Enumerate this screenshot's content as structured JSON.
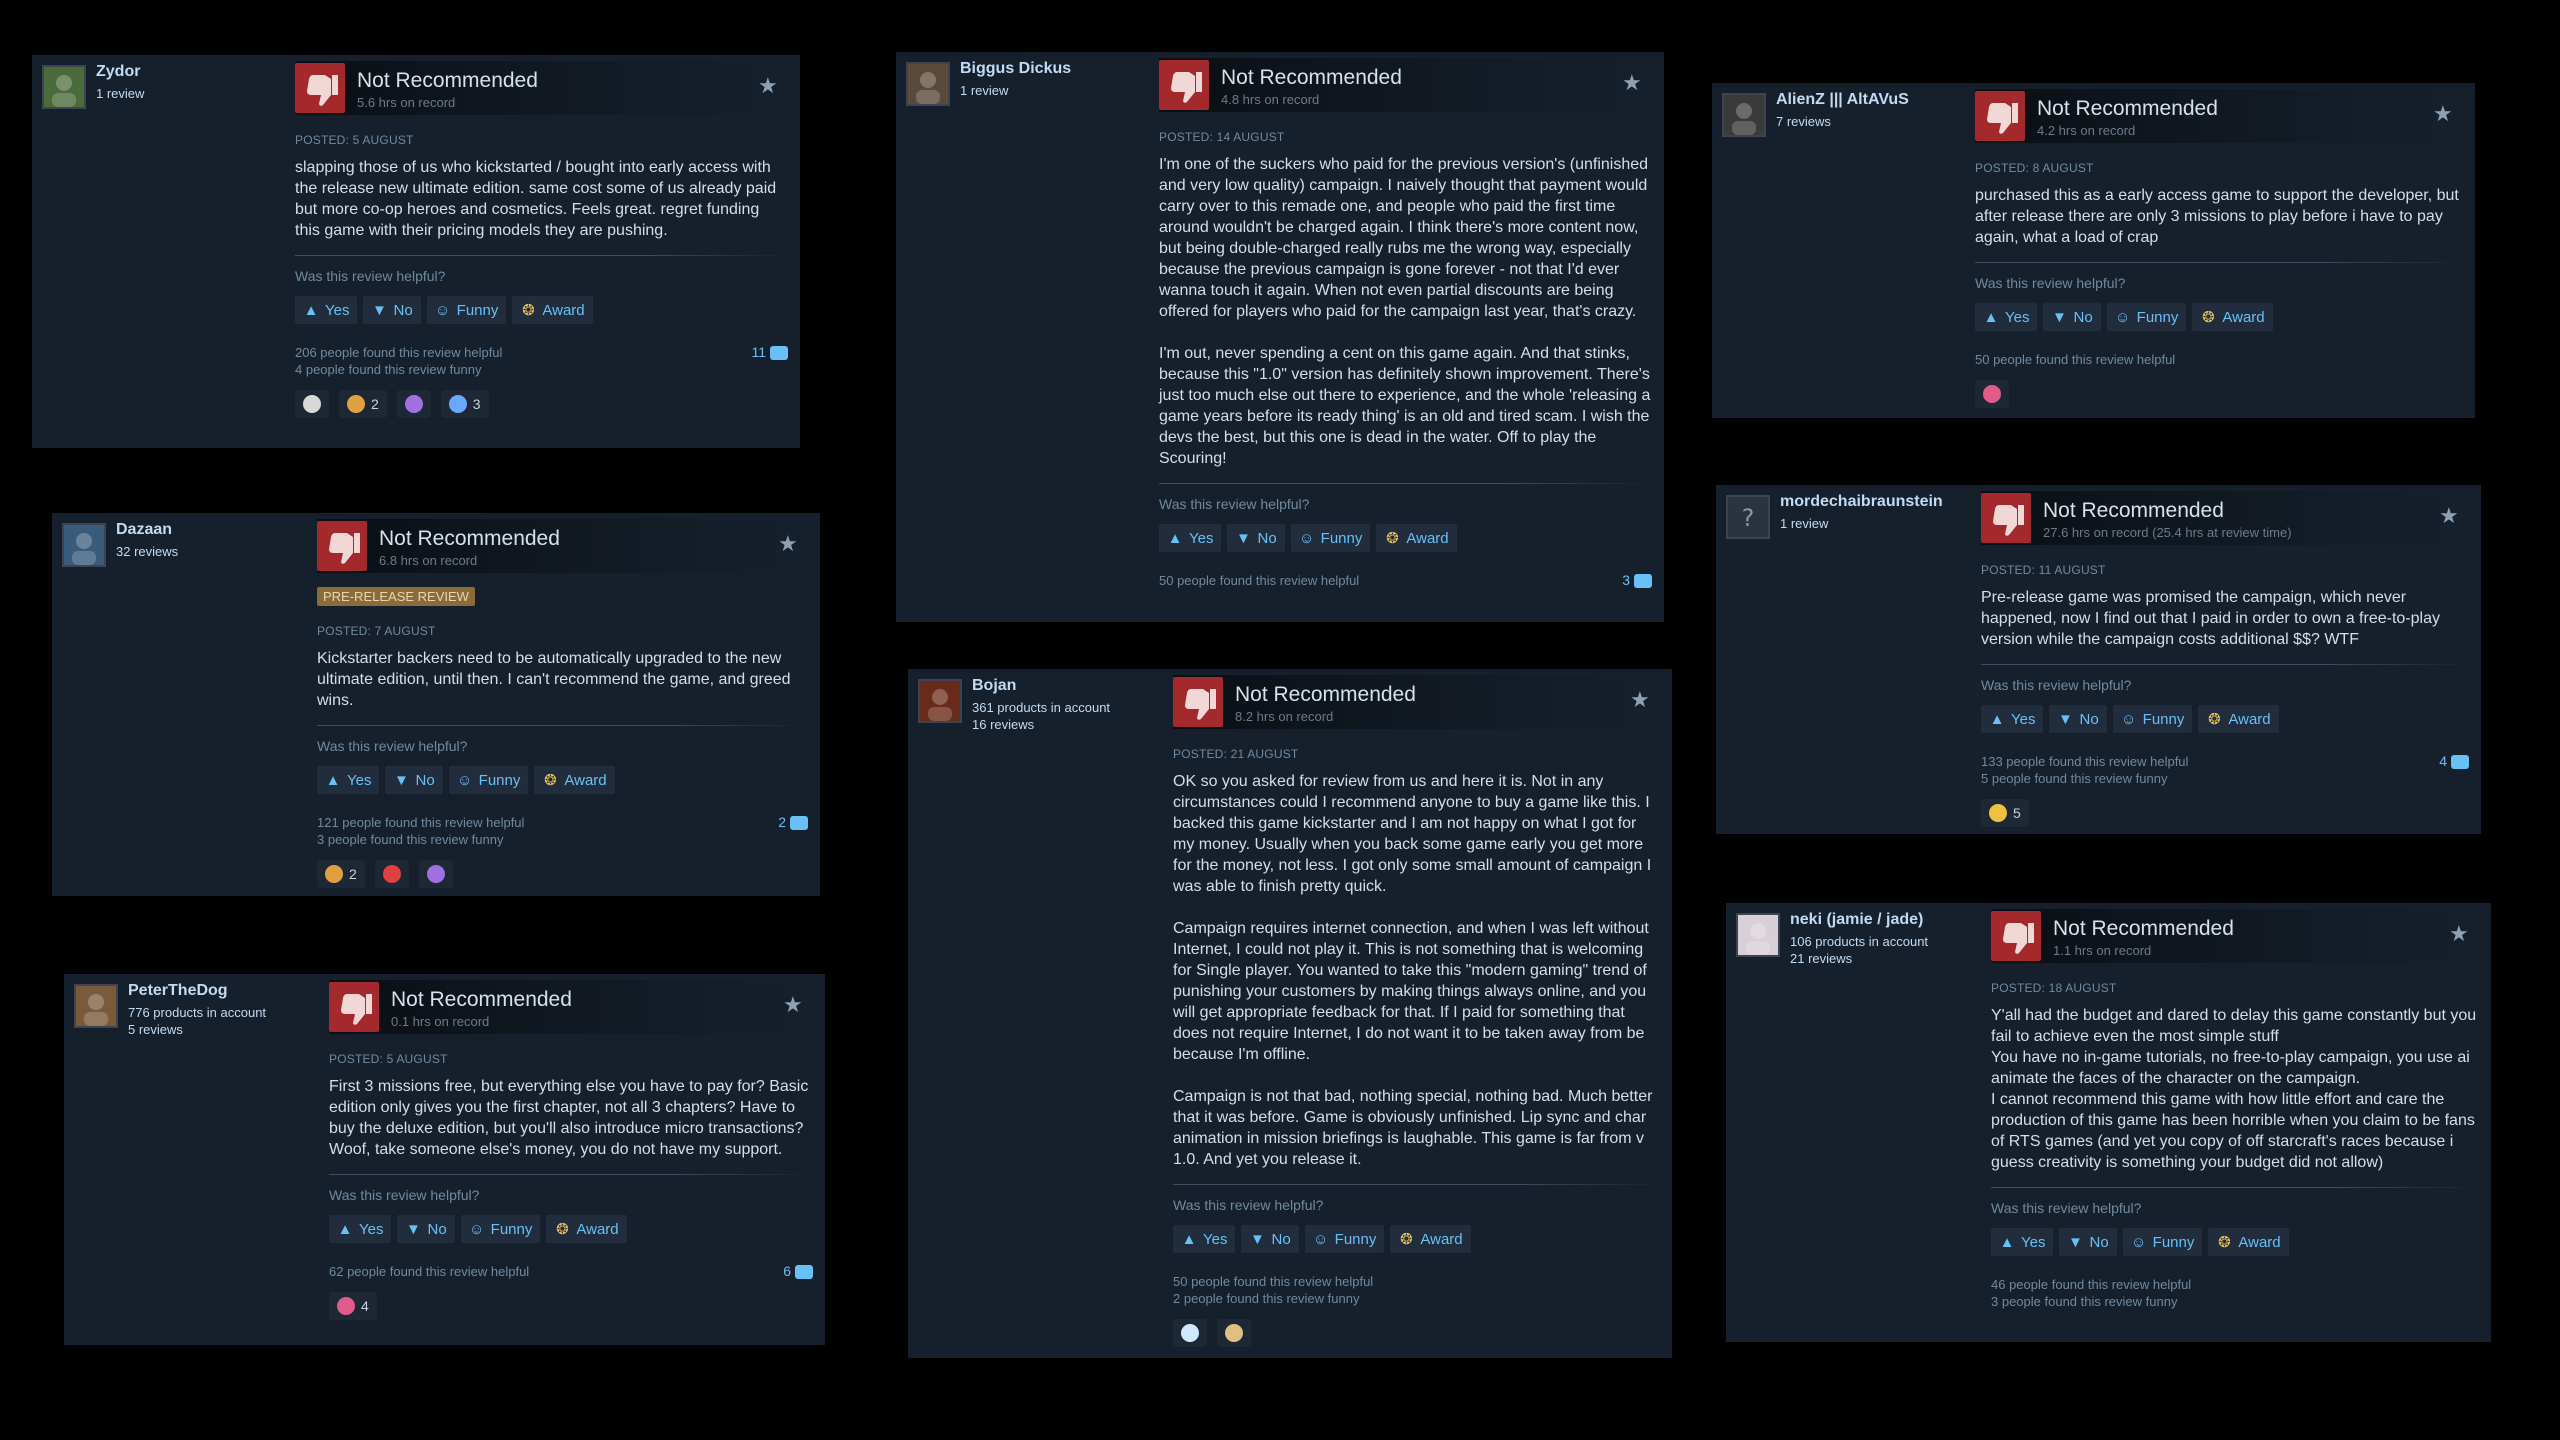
{
  "common": {
    "title": "Not Recommended",
    "helpful_q": "Was this review helpful?",
    "yes": "Yes",
    "no": "No",
    "funny": "Funny",
    "award": "Award"
  },
  "reviews": [
    {
      "author": "Zydor",
      "meta1": "1 review",
      "meta2": "",
      "hours": "5.6 hrs on record",
      "prerelease": "",
      "posted": "POSTED: 5 AUGUST",
      "text": "slapping those of us who kickstarted / bought into early access with the release new ultimate edition. same cost some of us already paid but more co-op heroes and cosmetics. Feels great. regret funding this game with their pricing models they are pushing.",
      "stat1": "206 people found this review helpful",
      "stat2": "4 people found this review funny",
      "comments": "11",
      "awards": [
        {
          "icon": "wings-award-icon",
          "count": "",
          "color": "#d8d8d8"
        },
        {
          "icon": "hands-award-icon",
          "count": "2",
          "color": "#e0a040"
        },
        {
          "icon": "heart-award-icon",
          "count": "",
          "color": "#a070e0"
        },
        {
          "icon": "ribbon-award-icon",
          "count": "3",
          "color": "#6aa8ff"
        }
      ]
    },
    {
      "author": "Biggus Dickus",
      "meta1": "1 review",
      "meta2": "",
      "hours": "4.8 hrs on record",
      "prerelease": "",
      "posted": "POSTED: 14 AUGUST",
      "text": "I'm one of the suckers who paid for the previous version's (unfinished and very low quality) campaign. I naively thought that payment would carry over to this remade one, and people who paid the first time around wouldn't be charged again. I think there's more content now, but being double-charged really rubs me the wrong way, especially because the previous campaign is gone forever - not that I'd ever wanna touch it again. When not even partial discounts are being offered for players who paid for the campaign last year, that's crazy.\n\nI'm out, never spending a cent on this game again. And that stinks, because this \"1.0\" version has definitely shown improvement. There's just too much else out there to experience, and the whole 'releasing a game years before its ready thing' is an old and tired scam. I wish the devs the best, but this one is dead in the water. Off to play the Scouring!",
      "stat1": "50 people found this review helpful",
      "stat2": "",
      "comments": "3",
      "awards": []
    },
    {
      "author": "AlienZ ||| AltAVuS",
      "meta1": "7 reviews",
      "meta2": "",
      "hours": "4.2 hrs on record",
      "prerelease": "",
      "posted": "POSTED: 8 AUGUST",
      "text": "purchased this as a early access game to support the developer, but after release there are only 3 missions to play before i have to pay again, what a load of crap",
      "stat1": "50 people found this review helpful",
      "stat2": "",
      "comments": "",
      "awards": [
        {
          "icon": "ufo-award-icon",
          "count": "",
          "color": "#e05a8a"
        }
      ]
    },
    {
      "author": "Dazaan",
      "meta1": "32 reviews",
      "meta2": "",
      "hours": "6.8 hrs on record",
      "prerelease": "PRE-RELEASE REVIEW",
      "posted": "POSTED: 7 AUGUST",
      "text": "Kickstarter backers need to be automatically upgraded to the new ultimate edition, until then. I can't recommend the game, and greed wins.",
      "stat1": "121 people found this review helpful",
      "stat2": "3 people found this review funny",
      "comments": "2",
      "awards": [
        {
          "icon": "hands-award-icon",
          "count": "2",
          "color": "#e0a040"
        },
        {
          "icon": "firework-award-icon",
          "count": "",
          "color": "#e04040"
        },
        {
          "icon": "heart-award-icon",
          "count": "",
          "color": "#a070e0"
        }
      ]
    },
    {
      "author": "mordechaibraunstein",
      "meta1": "1 review",
      "meta2": "",
      "hours": "27.6 hrs on record (25.4 hrs at review time)",
      "prerelease": "",
      "posted": "POSTED: 11 AUGUST",
      "text": "Pre-release game was promised the campaign, which never happened, now I find out that I paid in order to own a free-to-play version while the campaign costs additional $$? WTF",
      "stat1": "133 people found this review helpful",
      "stat2": "5 people found this review funny",
      "comments": "4",
      "awards": [
        {
          "icon": "laugh-award-icon",
          "count": "5",
          "color": "#f0c040"
        }
      ]
    },
    {
      "author": "Bojan",
      "meta1": "361 products in account",
      "meta2": "16 reviews",
      "hours": "8.2 hrs on record",
      "prerelease": "",
      "posted": "POSTED: 21 AUGUST",
      "text": "OK so you asked for review from us and here it is. Not in any circumstances could I recommend anyone to buy a game like this. I backed this game kickstarter and I am not happy on what I got for my money. Usually when you back some game early you get more for the money, not less. I got only some small amount of campaign I was able to finish pretty quick.\n\nCampaign requires internet connection, and when I was left without Internet, I could not play it. This is not something that is welcoming for Single player. You wanted to take this \"modern gaming\" trend of punishing your customers by making things always online, and you will get appropriate feedback for that. If I paid for something that does not require Internet, I do not want it to be taken away from be because I'm offline.\n\nCampaign is not that bad, nothing special, nothing bad. Much better that it was before. Game is obviously unfinished. Lip sync and char animation in mission briefings is laughable. This game is far from v 1.0. And yet you release it.",
      "stat1": "50 people found this review helpful",
      "stat2": "2 people found this review funny",
      "comments": "",
      "awards": [
        {
          "icon": "eye-award-icon",
          "count": "",
          "color": "#d0e8ff"
        },
        {
          "icon": "scroll-award-icon",
          "count": "",
          "color": "#e0c080"
        }
      ]
    },
    {
      "author": "PeterTheDog",
      "meta1": "776 products in account",
      "meta2": "5 reviews",
      "hours": "0.1 hrs on record",
      "prerelease": "",
      "posted": "POSTED: 5 AUGUST",
      "text": "First 3 missions free, but everything else you have to pay for? Basic edition only gives you the first chapter, not all 3 chapters? Have to buy the deluxe edition, but you'll also introduce micro transactions? Woof, take someone else's money, you do not have my support.",
      "stat1": "62 people found this review helpful",
      "stat2": "",
      "comments": "6",
      "awards": [
        {
          "icon": "ufo-award-icon",
          "count": "4",
          "color": "#e05a8a"
        }
      ]
    },
    {
      "author": "neki (jamie / jade)",
      "meta1": "106 products in account",
      "meta2": "21 reviews",
      "hours": "1.1 hrs on record",
      "prerelease": "",
      "posted": "POSTED: 18 AUGUST",
      "text": "Y'all had the budget and dared to delay this game constantly but you fail to achieve even the most simple stuff\nYou have no in-game tutorials, no free-to-play campaign, you use ai animate the faces of the character on the campaign.\nI cannot recommend this game with how little effort and care the production of this game has been horrible when you claim to be fans of RTS games (and yet you copy of off starcraft's races because i guess creativity is something your budget did not allow)",
      "stat1": "46 people found this review helpful",
      "stat2": "3 people found this review funny",
      "comments": "",
      "awards": []
    }
  ]
}
